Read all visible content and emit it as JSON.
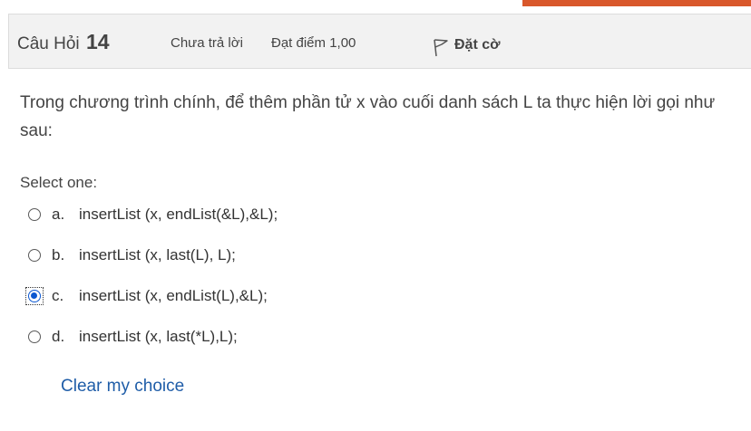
{
  "header": {
    "question_label": "Câu Hỏi",
    "question_number": "14",
    "state": "Chưa trả lời",
    "grade": "Đạt điểm 1,00",
    "flag_label": "Đặt cờ"
  },
  "question_text": "Trong chương trình chính, để thêm phần tử x vào cuối danh sách L ta thực hiện lời gọi như sau:",
  "prompt": "Select one:",
  "options": [
    {
      "letter": "a.",
      "text": "insertList (x, endList(&L),&L);",
      "checked": false
    },
    {
      "letter": "b.",
      "text": "insertList (x, last(L), L);",
      "checked": false
    },
    {
      "letter": "c.",
      "text": "insertList (x, endList(L),&L);",
      "checked": true
    },
    {
      "letter": "d.",
      "text": "insertList (x, last(*L),L);",
      "checked": false
    }
  ],
  "clear_label": "Clear my choice",
  "colors": {
    "accent": "#d9582b",
    "link": "#1f5da8",
    "selected": "#0b57d0"
  }
}
